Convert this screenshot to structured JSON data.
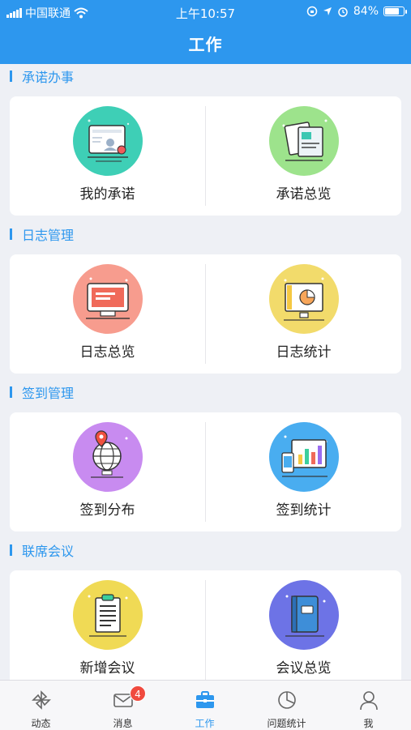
{
  "status": {
    "carrier": "中国联通",
    "time": "上午10:57",
    "battery": "84%",
    "battery_level": 0.84
  },
  "header": {
    "title": "工作"
  },
  "sections": [
    {
      "title": "承诺办事",
      "items": [
        {
          "label": "我的承诺",
          "icon": "id-card-icon",
          "color": "#3ecfb6"
        },
        {
          "label": "承诺总览",
          "icon": "documents-icon",
          "color": "#9de38c"
        }
      ]
    },
    {
      "title": "日志管理",
      "items": [
        {
          "label": "日志总览",
          "icon": "monitor-icon",
          "color": "#f79c8e"
        },
        {
          "label": "日志统计",
          "icon": "pie-chart-board-icon",
          "color": "#f2db6b"
        }
      ]
    },
    {
      "title": "签到管理",
      "items": [
        {
          "label": "签到分布",
          "icon": "globe-location-icon",
          "color": "#c88bf0"
        },
        {
          "label": "签到统计",
          "icon": "bar-chart-board-icon",
          "color": "#49adf0"
        }
      ]
    },
    {
      "title": "联席会议",
      "items": [
        {
          "label": "新增会议",
          "icon": "clipboard-icon",
          "color": "#f0da55"
        },
        {
          "label": "会议总览",
          "icon": "book-icon",
          "color": "#6d73e6"
        }
      ]
    }
  ],
  "tabbar": {
    "tabs": [
      {
        "label": "动态",
        "icon": "pinwheel-icon"
      },
      {
        "label": "消息",
        "icon": "mail-icon",
        "badge": "4"
      },
      {
        "label": "工作",
        "icon": "briefcase-icon",
        "active": true
      },
      {
        "label": "问题统计",
        "icon": "pie-icon"
      },
      {
        "label": "我",
        "icon": "user-icon"
      }
    ]
  }
}
